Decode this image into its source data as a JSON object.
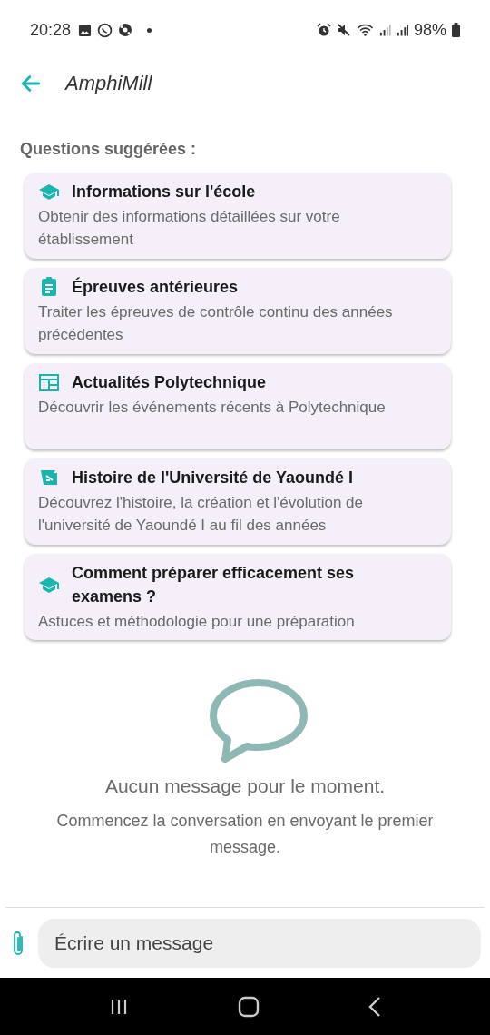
{
  "status_bar": {
    "time": "20:28",
    "battery": "98%"
  },
  "header": {
    "title": "AmphiMill"
  },
  "suggestions": {
    "title": "Questions suggérées :",
    "items": [
      {
        "kind": "school",
        "title": "Informations sur l'école",
        "description": "Obtenir des informations détaillées sur votre établissement"
      },
      {
        "kind": "assignment",
        "title": "Épreuves antérieures",
        "description": "Traiter les épreuves de contrôle continu des années précédentes"
      },
      {
        "kind": "news",
        "title": "Actualités Polytechnique",
        "description": "Découvrir les événements récents à Polytechnique"
      },
      {
        "kind": "history",
        "title": "Histoire de l'Université de Yaoundé I",
        "description": "Découvrez l'histoire, la création et l'évolution de l'université de Yaoundé I au fil des années"
      },
      {
        "kind": "school",
        "title": "Comment préparer efficacement ses examens ?",
        "description": "Astuces et méthodologie pour une préparation"
      }
    ]
  },
  "empty_state": {
    "title": "Aucun message pour le moment.",
    "subtitle": "Commencez la conversation en envoyant le premier message."
  },
  "composer": {
    "placeholder": "Écrire un message"
  }
}
